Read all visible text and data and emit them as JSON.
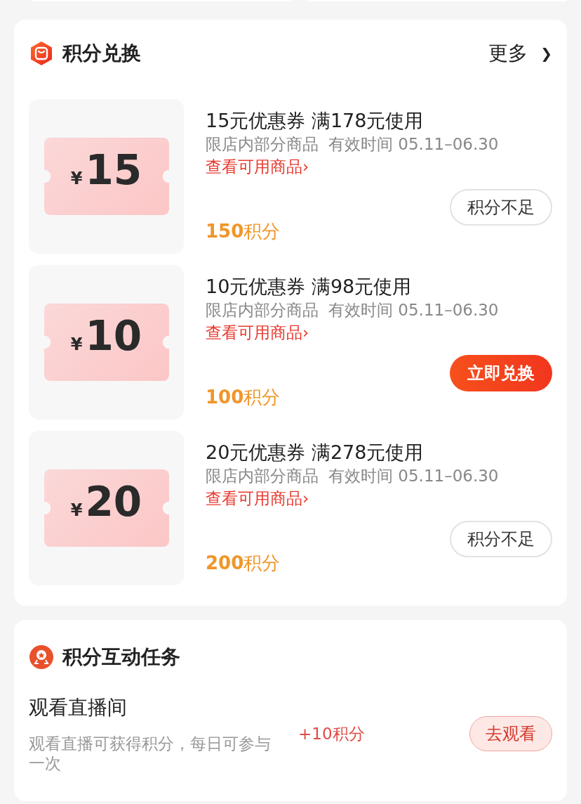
{
  "exchange": {
    "title": "积分兑换",
    "more": "更多",
    "more_arrow": "❯",
    "coupons": [
      {
        "currency": "¥",
        "amount": "15",
        "title": "15元优惠券 满178元使用",
        "scope": "限店内部分商品",
        "validity": "有效时间 05.11–06.30",
        "link": "查看可用商品›",
        "points": "**150**积分",
        "button": {
          "label": "积分不足",
          "disabled": true
        }
      },
      {
        "currency": "¥",
        "amount": "10",
        "title": "10元优惠券 满98元使用",
        "scope": "限店内部分商品",
        "validity": "有效时间 05.11–06.30",
        "link": "查看可用商品›",
        "points": "**100**积分",
        "button": {
          "label": "立即兑换",
          "disabled": false
        }
      },
      {
        "currency": "¥",
        "amount": "20",
        "title": "20元优惠券 满278元使用",
        "scope": "限店内部分商品",
        "validity": "有效时间 05.11–06.30",
        "link": "查看可用商品›",
        "points": "**200**积分",
        "button": {
          "label": "积分不足",
          "disabled": true
        }
      }
    ]
  },
  "tasks": {
    "title": "积分互动任务",
    "items": [
      {
        "name": "观看直播间",
        "description": "观看直播可获得积分，每日可参与一次",
        "reward": "+10积分",
        "button": "去观看"
      }
    ]
  }
}
